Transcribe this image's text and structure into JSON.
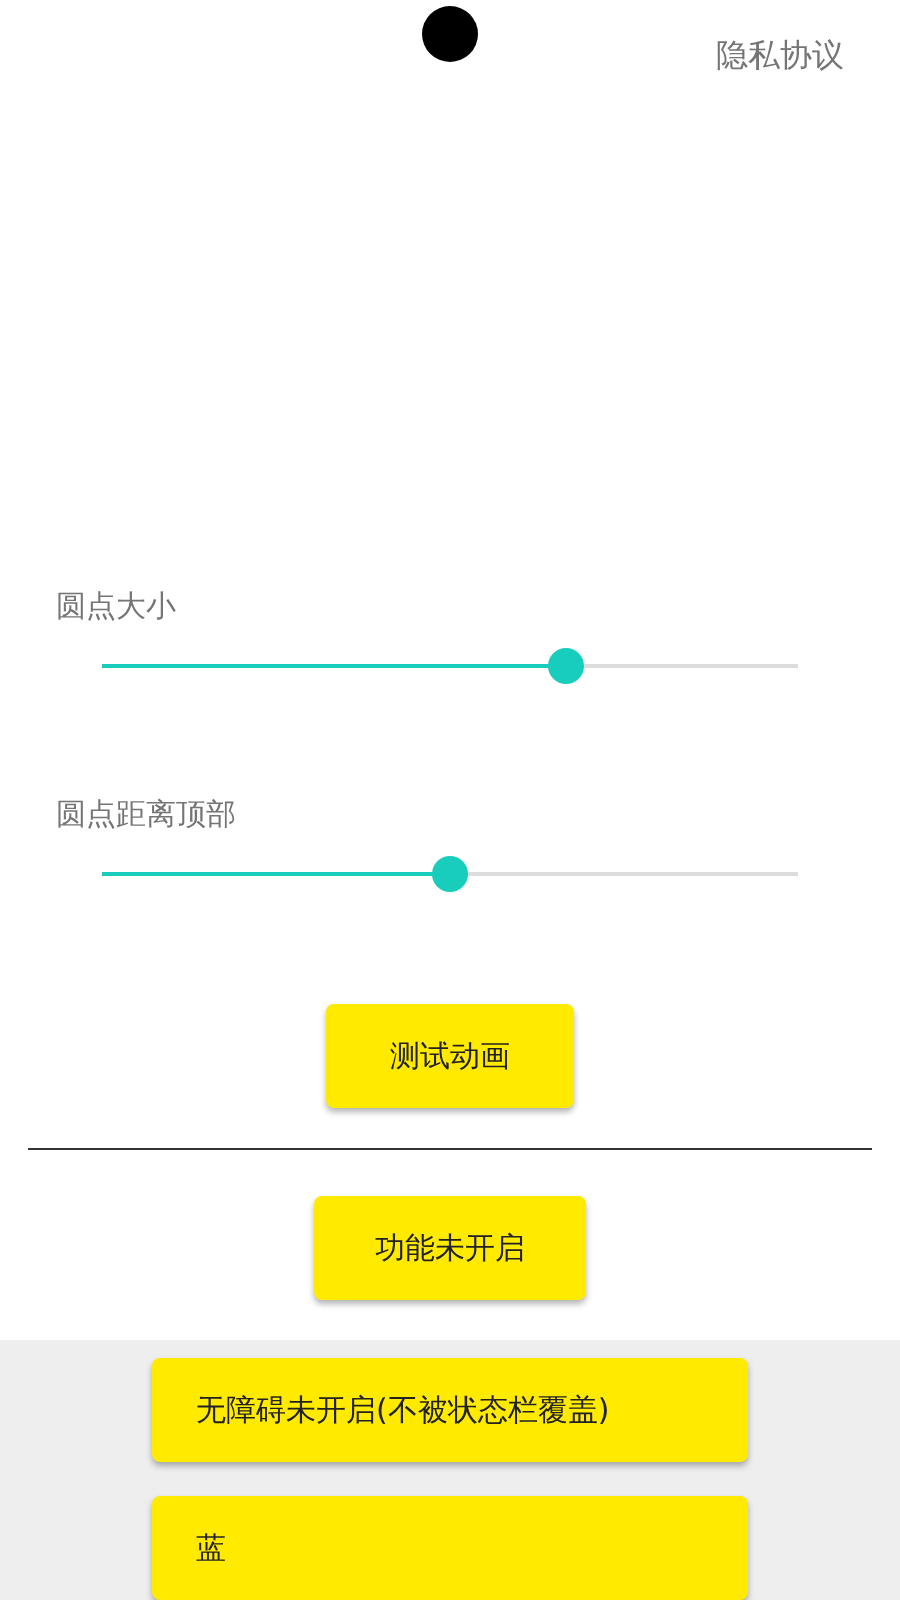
{
  "privacy_link": "隐私协议",
  "sliders": [
    {
      "label": "圆点大小",
      "level": 0.667
    },
    {
      "label": "圆点距离顶部",
      "level": 0.5
    }
  ],
  "test_button": "测试动画",
  "status_button": "功能未开启",
  "bottom_buttons": [
    "无障碍未开启(不被状态栏覆盖)",
    "蓝"
  ]
}
